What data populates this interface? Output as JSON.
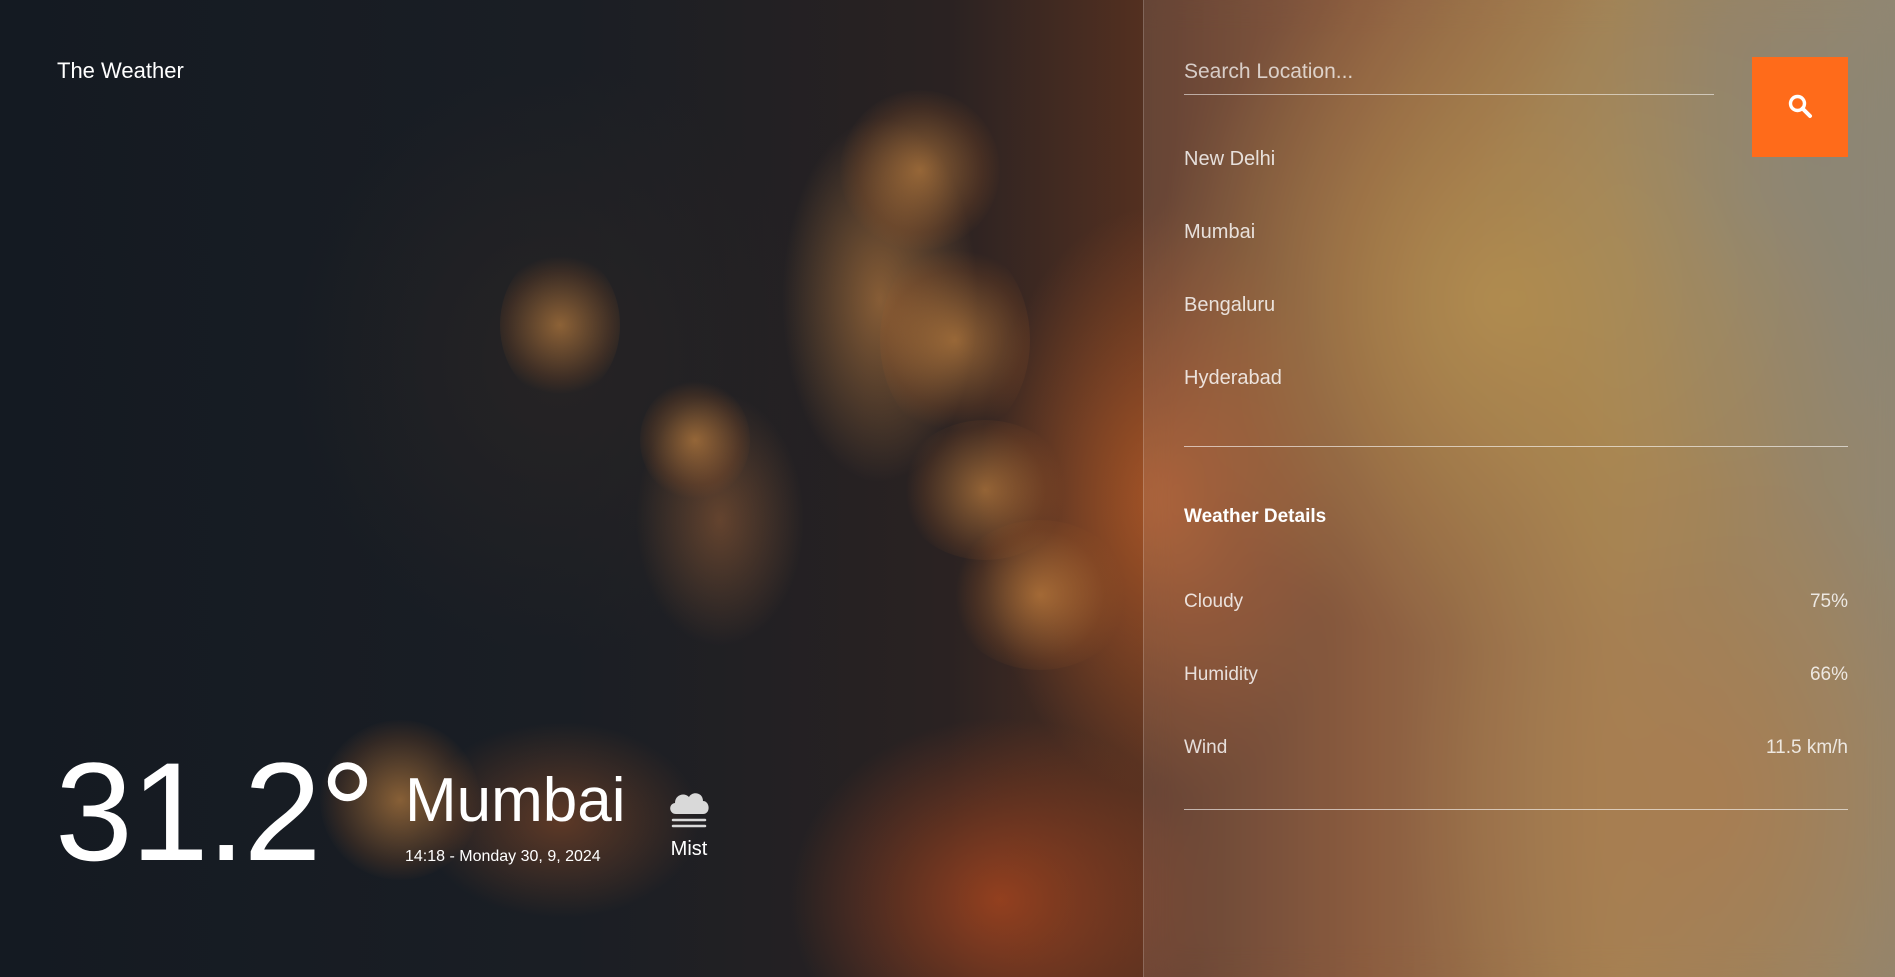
{
  "brand": {
    "title": "The Weather"
  },
  "current": {
    "temperature": "31.2°",
    "city": "Mumbai",
    "datetime": "14:18 - Monday 30, 9, 2024",
    "condition": "Mist",
    "condition_icon": "mist-cloud-icon"
  },
  "search": {
    "placeholder": "Search Location...",
    "value": "",
    "button_icon": "search-icon",
    "button_color": "#ff6b1a"
  },
  "locations": [
    "New Delhi",
    "Mumbai",
    "Bengaluru",
    "Hyderabad"
  ],
  "details": {
    "title": "Weather Details",
    "rows": [
      {
        "label": "Cloudy",
        "value": "75%"
      },
      {
        "label": "Humidity",
        "value": "66%"
      },
      {
        "label": "Wind",
        "value": "11.5 km/h"
      }
    ]
  }
}
